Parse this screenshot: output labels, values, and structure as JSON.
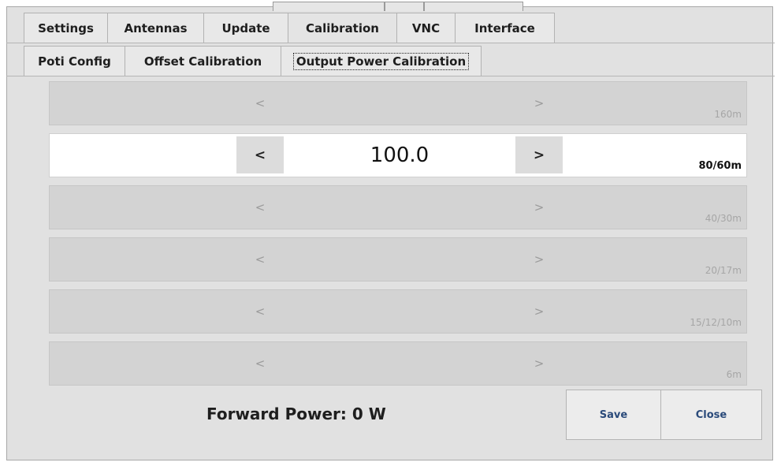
{
  "tabs": [
    {
      "label": "Settings",
      "active": false
    },
    {
      "label": "Antennas",
      "active": false
    },
    {
      "label": "Update",
      "active": false
    },
    {
      "label": "Calibration",
      "active": true
    },
    {
      "label": "VNC",
      "active": false
    },
    {
      "label": "Interface",
      "active": false
    }
  ],
  "subtabs": [
    {
      "label": "Poti Config",
      "active": false
    },
    {
      "label": "Offset Calibration",
      "active": false
    },
    {
      "label": "Output Power Calibration",
      "active": true
    }
  ],
  "rows": [
    {
      "band": "160m",
      "value": "",
      "prev": "<",
      "next": ">",
      "active": false
    },
    {
      "band": "80/60m",
      "value": "100.0",
      "prev": "<",
      "next": ">",
      "active": true
    },
    {
      "band": "40/30m",
      "value": "",
      "prev": "<",
      "next": ">",
      "active": false
    },
    {
      "band": "20/17m",
      "value": "",
      "prev": "<",
      "next": ">",
      "active": false
    },
    {
      "band": "15/12/10m",
      "value": "",
      "prev": "<",
      "next": ">",
      "active": false
    },
    {
      "band": "6m",
      "value": "",
      "prev": "<",
      "next": ">",
      "active": false
    }
  ],
  "forward_power": "Forward Power:  0 W",
  "buttons": {
    "save": "Save",
    "close": "Close"
  }
}
